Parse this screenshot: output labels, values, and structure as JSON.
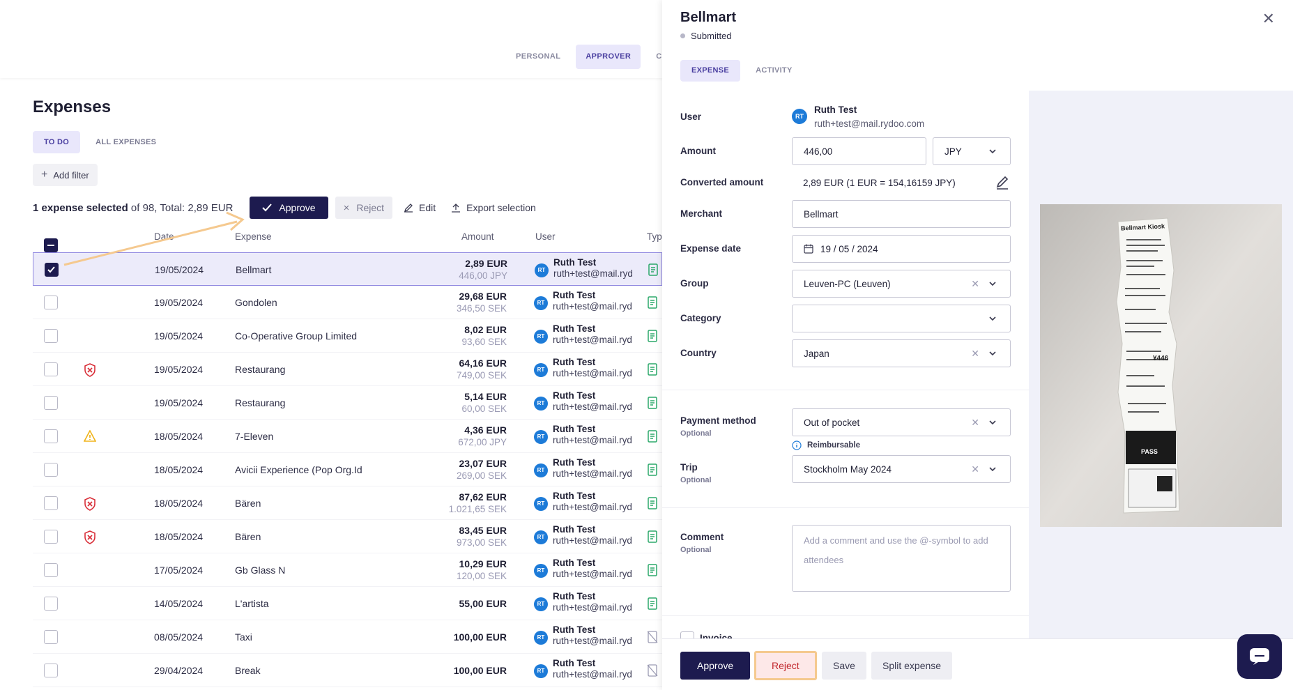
{
  "topbar": {
    "tabs": [
      "PERSONAL",
      "APPROVER",
      "C"
    ]
  },
  "page": {
    "title": "Expenses",
    "filter_tabs": [
      "TO DO",
      "ALL EXPENSES"
    ],
    "add_filter": "Add filter",
    "selection": {
      "count_text": "1 expense selected",
      "rest_text": " of 98, Total: 2,89 EUR"
    },
    "actions": {
      "approve": "Approve",
      "reject": "Reject",
      "edit": "Edit",
      "export": "Export selection"
    },
    "columns": [
      "Date",
      "Expense",
      "Amount",
      "User",
      "Type"
    ]
  },
  "rows": [
    {
      "date": "19/05/2024",
      "expense": "Bellmart",
      "amount": "2,89 EUR",
      "orig": "446,00 JPY",
      "flag": "",
      "selected": true
    },
    {
      "date": "19/05/2024",
      "expense": "Gondolen",
      "amount": "29,68 EUR",
      "orig": "346,50 SEK",
      "flag": ""
    },
    {
      "date": "19/05/2024",
      "expense": "Co-Operative Group Limited",
      "amount": "8,02 EUR",
      "orig": "93,60 SEK",
      "flag": ""
    },
    {
      "date": "19/05/2024",
      "expense": "Restaurang",
      "amount": "64,16 EUR",
      "orig": "749,00 SEK",
      "flag": "shield"
    },
    {
      "date": "19/05/2024",
      "expense": "Restaurang",
      "amount": "5,14 EUR",
      "orig": "60,00 SEK",
      "flag": ""
    },
    {
      "date": "18/05/2024",
      "expense": "7-Eleven",
      "amount": "4,36 EUR",
      "orig": "672,00 JPY",
      "flag": "warning"
    },
    {
      "date": "18/05/2024",
      "expense": "Avicii Experience (Pop Org.Id",
      "amount": "23,07 EUR",
      "orig": "269,00 SEK",
      "flag": ""
    },
    {
      "date": "18/05/2024",
      "expense": "Bären",
      "amount": "87,62 EUR",
      "orig": "1.021,65 SEK",
      "flag": "shield"
    },
    {
      "date": "18/05/2024",
      "expense": "Bären",
      "amount": "83,45 EUR",
      "orig": "973,00 SEK",
      "flag": "shield"
    },
    {
      "date": "17/05/2024",
      "expense": "Gb Glass N",
      "amount": "10,29 EUR",
      "orig": "120,00 SEK",
      "flag": ""
    },
    {
      "date": "14/05/2024",
      "expense": "L'artista",
      "amount": "55,00 EUR",
      "orig": "",
      "flag": ""
    },
    {
      "date": "08/05/2024",
      "expense": "Taxi",
      "amount": "100,00 EUR",
      "orig": "",
      "flag": "",
      "type": "no-receipt"
    },
    {
      "date": "29/04/2024",
      "expense": "Break",
      "amount": "100,00 EUR",
      "orig": "",
      "flag": "",
      "type": "no-receipt"
    }
  ],
  "user": {
    "initials": "RT",
    "name": "Ruth Test",
    "email_short": "ruth+test@mail.ryd"
  },
  "panel": {
    "title": "Bellmart",
    "status": "Submitted",
    "tabs": [
      "EXPENSE",
      "ACTIVITY"
    ],
    "labels": {
      "user": "User",
      "amount": "Amount",
      "converted": "Converted amount",
      "merchant": "Merchant",
      "expense_date": "Expense date",
      "group": "Group",
      "category": "Category",
      "country": "Country",
      "payment": "Payment method",
      "trip": "Trip",
      "comment": "Comment",
      "optional": "Optional",
      "invoice": "Invoice"
    },
    "values": {
      "user_name": "Ruth Test",
      "user_email": "ruth+test@mail.rydoo.com",
      "amount": "446,00",
      "currency": "JPY",
      "converted": "2,89 EUR (1 EUR = 154,16159 JPY)",
      "merchant": "Bellmart",
      "date": "19 / 05 / 2024",
      "group": "Leuven-PC (Leuven)",
      "category": "",
      "country": "Japan",
      "payment": "Out of pocket",
      "reimbursable": "Reimbursable",
      "trip": "Stockholm May 2024",
      "comment_placeholder": "Add a comment and use the @-symbol to add attendees"
    },
    "footer": {
      "approve": "Approve",
      "reject": "Reject",
      "save": "Save",
      "split": "Split expense"
    },
    "receipt": {
      "header": "Bellmart Kiosk",
      "total": "¥446",
      "promo": "PASS"
    }
  },
  "colors": {
    "primary": "#1d1b4f",
    "accent": "#e9e7fb",
    "avatar": "#1d7bd8",
    "shield": "#d9303a",
    "warning": "#f0b41b",
    "highlight": "#f5c98f"
  }
}
